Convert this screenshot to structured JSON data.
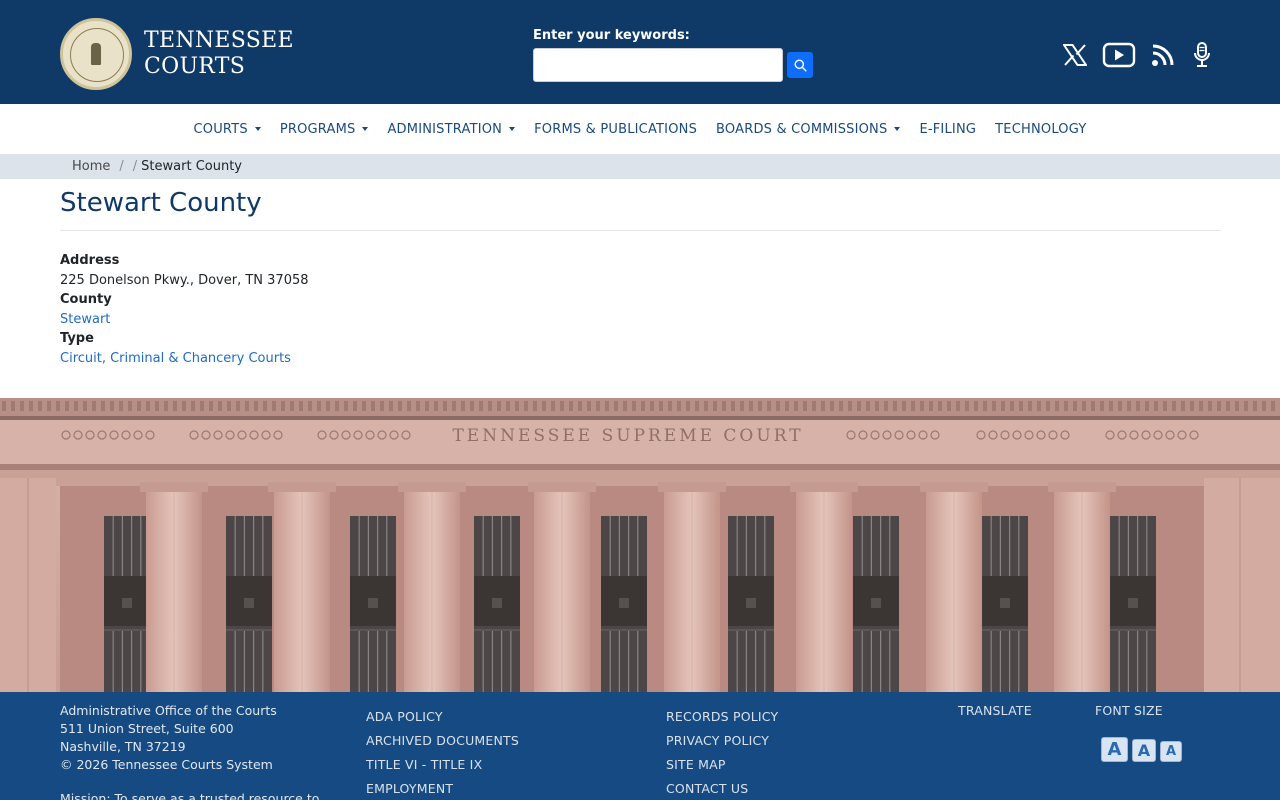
{
  "header": {
    "logo_line1": "TENNESSEE",
    "logo_line2": "COURTS",
    "seal_text": "SEAL OF THE TENNESSEE JUDICIARY",
    "search_label": "Enter your keywords:",
    "search_value": "",
    "social_icons": [
      "x-icon",
      "youtube-icon",
      "rss-icon",
      "podcast-mic-icon"
    ]
  },
  "nav": {
    "items": [
      {
        "label": "COURTS",
        "dropdown": true
      },
      {
        "label": "PROGRAMS",
        "dropdown": true
      },
      {
        "label": "ADMINISTRATION",
        "dropdown": true
      },
      {
        "label": "FORMS & PUBLICATIONS",
        "dropdown": false
      },
      {
        "label": "BOARDS & COMMISSIONS",
        "dropdown": true
      },
      {
        "label": "E-FILING",
        "dropdown": false
      },
      {
        "label": "TECHNOLOGY",
        "dropdown": false
      }
    ]
  },
  "breadcrumb": {
    "home": "Home",
    "separator": "/",
    "current": "Stewart County"
  },
  "page": {
    "title": "Stewart County",
    "address_label": "Address",
    "address_value": "225 Donelson Pkwy., Dover, TN 37058",
    "county_label": "County",
    "county_value": "Stewart",
    "type_label": "Type",
    "type_value": "Circuit, Criminal & Chancery Courts"
  },
  "hero": {
    "inscription": "TENNESSEE SUPREME COURT"
  },
  "footer": {
    "org": "Administrative Office of the Courts",
    "street": "511 Union Street, Suite 600",
    "city": "Nashville, TN 37219",
    "copyright": "© 2026 Tennessee Courts System",
    "mission": "Mission: To serve as a trusted resource to",
    "links_col2": [
      "ADA POLICY",
      "ARCHIVED DOCUMENTS",
      "TITLE VI - TITLE IX",
      "EMPLOYMENT"
    ],
    "links_col3": [
      "RECORDS POLICY",
      "PRIVACY POLICY",
      "SITE MAP",
      "CONTACT US"
    ],
    "translate": "TRANSLATE",
    "font_size": "FONT SIZE",
    "font_buttons": [
      "A",
      "A",
      "A"
    ]
  },
  "colors": {
    "header_bg": "#0f3a68",
    "footer_bg": "#164a82",
    "link": "#1f6bc4",
    "breadcrumb_bg": "#dce3eb",
    "search_button": "#0d6efd"
  }
}
